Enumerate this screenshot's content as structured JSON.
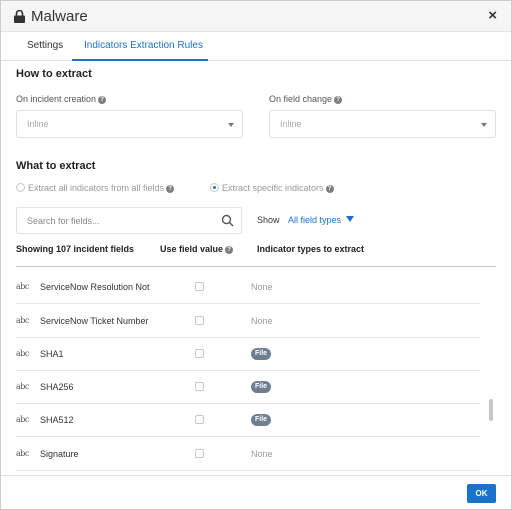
{
  "dialog": {
    "title": "Malware",
    "close_label": "×"
  },
  "tabs": [
    {
      "label": "Settings"
    },
    {
      "label": "Indicators Extraction Rules"
    }
  ],
  "how": {
    "title": "How to extract",
    "on_creation": {
      "label": "On incident creation",
      "value": "Inline"
    },
    "on_change": {
      "label": "On field change",
      "value": "Inline"
    }
  },
  "what": {
    "title": "What to extract",
    "radio_all": "Extract all indicators from all fields",
    "radio_specific": "Extract specific indicators",
    "selected": "Extract specific indicators"
  },
  "search": {
    "placeholder": "Search for fields..."
  },
  "show": {
    "label": "Show",
    "value": "All field types"
  },
  "columns": {
    "count": "Showing 107 incident fields",
    "use_value": "Use field value",
    "indicator_types": "Indicator types to extract"
  },
  "rows": [
    {
      "type": "abc",
      "name": "ServiceNow Resolution Not",
      "checked": false,
      "indicator": "None"
    },
    {
      "type": "abc",
      "name": "ServiceNow Ticket Number",
      "checked": false,
      "indicator": "None"
    },
    {
      "type": "abc",
      "name": "SHA1",
      "checked": false,
      "indicator": "File"
    },
    {
      "type": "abc",
      "name": "SHA256",
      "checked": false,
      "indicator": "File"
    },
    {
      "type": "abc",
      "name": "SHA512",
      "checked": false,
      "indicator": "File"
    },
    {
      "type": "abc",
      "name": "Signature",
      "checked": false,
      "indicator": "None"
    }
  ],
  "footer": {
    "ok_label": "OK"
  },
  "colors": {
    "accent": "#1a73c8",
    "badge": "#6f7f92"
  }
}
